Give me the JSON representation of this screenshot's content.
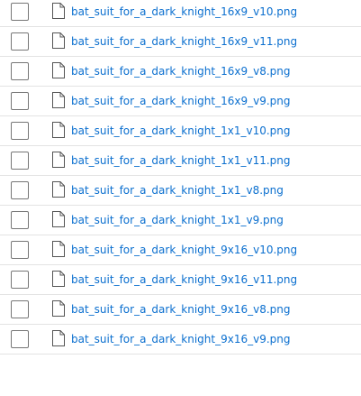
{
  "file_list": {
    "items": [
      {
        "name": "bat_suit_for_a_dark_knight_16x9_v10.png",
        "icon": "file-icon"
      },
      {
        "name": "bat_suit_for_a_dark_knight_16x9_v11.png",
        "icon": "file-icon"
      },
      {
        "name": "bat_suit_for_a_dark_knight_16x9_v8.png",
        "icon": "file-icon"
      },
      {
        "name": "bat_suit_for_a_dark_knight_16x9_v9.png",
        "icon": "file-icon"
      },
      {
        "name": "bat_suit_for_a_dark_knight_1x1_v10.png",
        "icon": "file-icon"
      },
      {
        "name": "bat_suit_for_a_dark_knight_1x1_v11.png",
        "icon": "file-icon"
      },
      {
        "name": "bat_suit_for_a_dark_knight_1x1_v8.png",
        "icon": "file-icon"
      },
      {
        "name": "bat_suit_for_a_dark_knight_1x1_v9.png",
        "icon": "file-icon"
      },
      {
        "name": "bat_suit_for_a_dark_knight_9x16_v10.png",
        "icon": "file-icon"
      },
      {
        "name": "bat_suit_for_a_dark_knight_9x16_v11.png",
        "icon": "file-icon"
      },
      {
        "name": "bat_suit_for_a_dark_knight_9x16_v8.png",
        "icon": "file-icon"
      },
      {
        "name": "bat_suit_for_a_dark_knight_9x16_v9.png",
        "icon": "file-icon"
      }
    ]
  },
  "colors": {
    "link": "#0b6fcf",
    "divider": "#e3e3e3",
    "checkbox_border": "#767676",
    "icon_stroke": "#555555"
  }
}
